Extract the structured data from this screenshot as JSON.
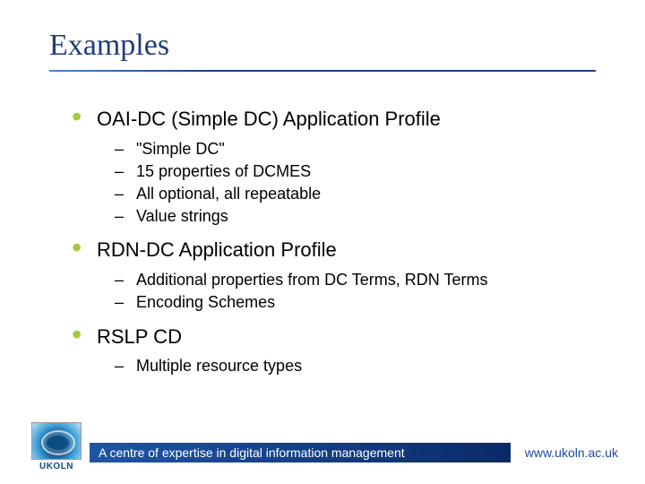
{
  "title": "Examples",
  "bullets": [
    {
      "label": "OAI-DC (Simple DC) Application Profile",
      "sub": [
        "\"Simple DC\"",
        "15 properties of DCMES",
        "All optional, all repeatable",
        "Value strings"
      ]
    },
    {
      "label": "RDN-DC Application Profile",
      "sub": [
        "Additional properties from DC Terms, RDN Terms",
        "Encoding Schemes"
      ]
    },
    {
      "label": "RSLP CD",
      "sub": [
        "Multiple resource types"
      ]
    }
  ],
  "footer": {
    "tagline": "A centre of expertise in digital information management",
    "url": "www.ukoln.ac.uk",
    "logo_label": "UKOLN"
  }
}
